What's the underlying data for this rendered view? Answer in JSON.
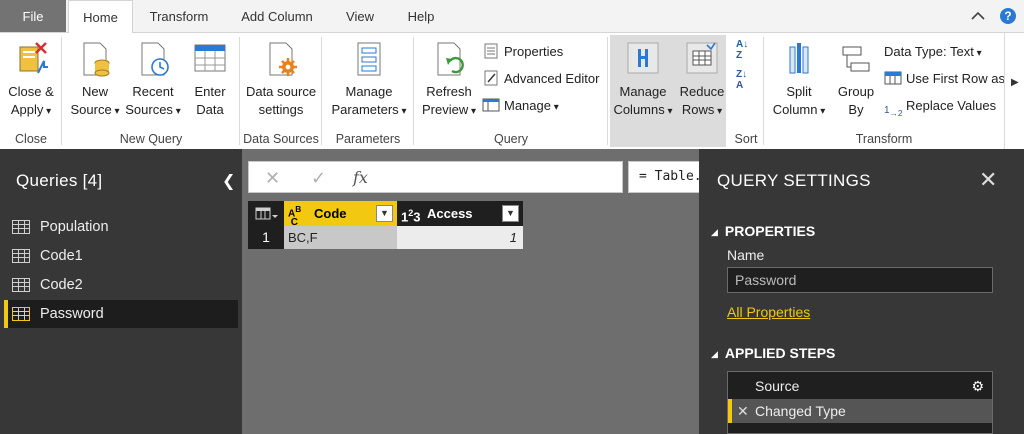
{
  "tabs": [
    "File",
    "Home",
    "Transform",
    "Add Column",
    "View",
    "Help"
  ],
  "ribbon": {
    "close": {
      "btn1": "Close &",
      "btn2": "Apply",
      "group": "Close"
    },
    "new_query": {
      "new_source": [
        "New",
        "Source"
      ],
      "recent_sources": [
        "Recent",
        "Sources"
      ],
      "enter_data": [
        "Enter",
        "Data"
      ],
      "group": "New Query"
    },
    "data_sources": {
      "btn": [
        "Data source",
        "settings"
      ],
      "group": "Data Sources"
    },
    "parameters": {
      "btn": [
        "Manage",
        "Parameters"
      ],
      "group": "Parameters"
    },
    "query": {
      "refresh": [
        "Refresh",
        "Preview"
      ],
      "properties": "Properties",
      "advanced_editor": "Advanced Editor",
      "manage": "Manage",
      "group": "Query"
    },
    "manage_columns": [
      "Manage",
      "Columns"
    ],
    "reduce_rows": [
      "Reduce",
      "Rows"
    ],
    "sort": {
      "group": "Sort"
    },
    "transform": {
      "split": [
        "Split",
        "Column"
      ],
      "group_by": [
        "Group",
        "By"
      ],
      "data_type": "Data Type: Text",
      "first_row": "Use First Row as H",
      "replace": "Replace Values",
      "group": "Transform"
    }
  },
  "queries": {
    "title": "Queries [4]",
    "items": [
      "Population",
      "Code1",
      "Code2",
      "Password"
    ],
    "selected": "Password"
  },
  "formula": "= Table.TransformColumnTypes",
  "grid": {
    "columns": [
      {
        "name": "Code",
        "type_icon": "ABC"
      },
      {
        "name": "Access",
        "type_icon": "123"
      }
    ],
    "rows": [
      {
        "num": "1",
        "code": "BC,F",
        "access": "1"
      }
    ]
  },
  "settings": {
    "title": "QUERY SETTINGS",
    "properties_heading": "PROPERTIES",
    "name_label": "Name",
    "name_value": "Password",
    "all_properties": "All Properties",
    "applied_heading": "APPLIED STEPS",
    "steps": [
      "Source",
      "Changed Type"
    ]
  },
  "colors": {
    "accent": "#f2c811",
    "dark_panel": "#373737",
    "grid_bg": "#6e6e6e"
  }
}
